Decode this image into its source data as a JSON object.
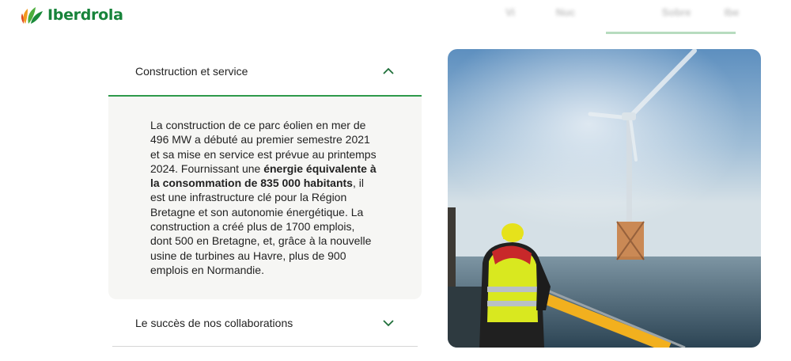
{
  "brand": {
    "name": "Iberdrola",
    "color": "#17833a",
    "accent": "#2e9a4a"
  },
  "topnav": {
    "items": [
      "Vi",
      "Nuc",
      "",
      "Sobre",
      "Ibe"
    ]
  },
  "accordion": {
    "section1": {
      "title": "Construction et service",
      "expanded": true,
      "text_before": "La construction de ce parc éolien en mer de 496 MW a débuté au premier semestre 2021 et sa mise en service est prévue au printemps 2024. Fournissant une ",
      "text_bold": "énergie équivalente à la consommation de 835 000 habitants",
      "text_after": ", il est une infrastructure clé pour la Région Bretagne et son autonomie énergétique. La construction a créé plus de 1700 emplois, dont 500 en Bretagne, et, grâce à la nouvelle usine de turbines au Havre, plus de 900 emplois en Normandie."
    },
    "section2": {
      "title": "Le succès de nos collaborations",
      "expanded": false
    }
  },
  "photo": {
    "subject": "worker-watching-offshore-wind-turbine"
  }
}
